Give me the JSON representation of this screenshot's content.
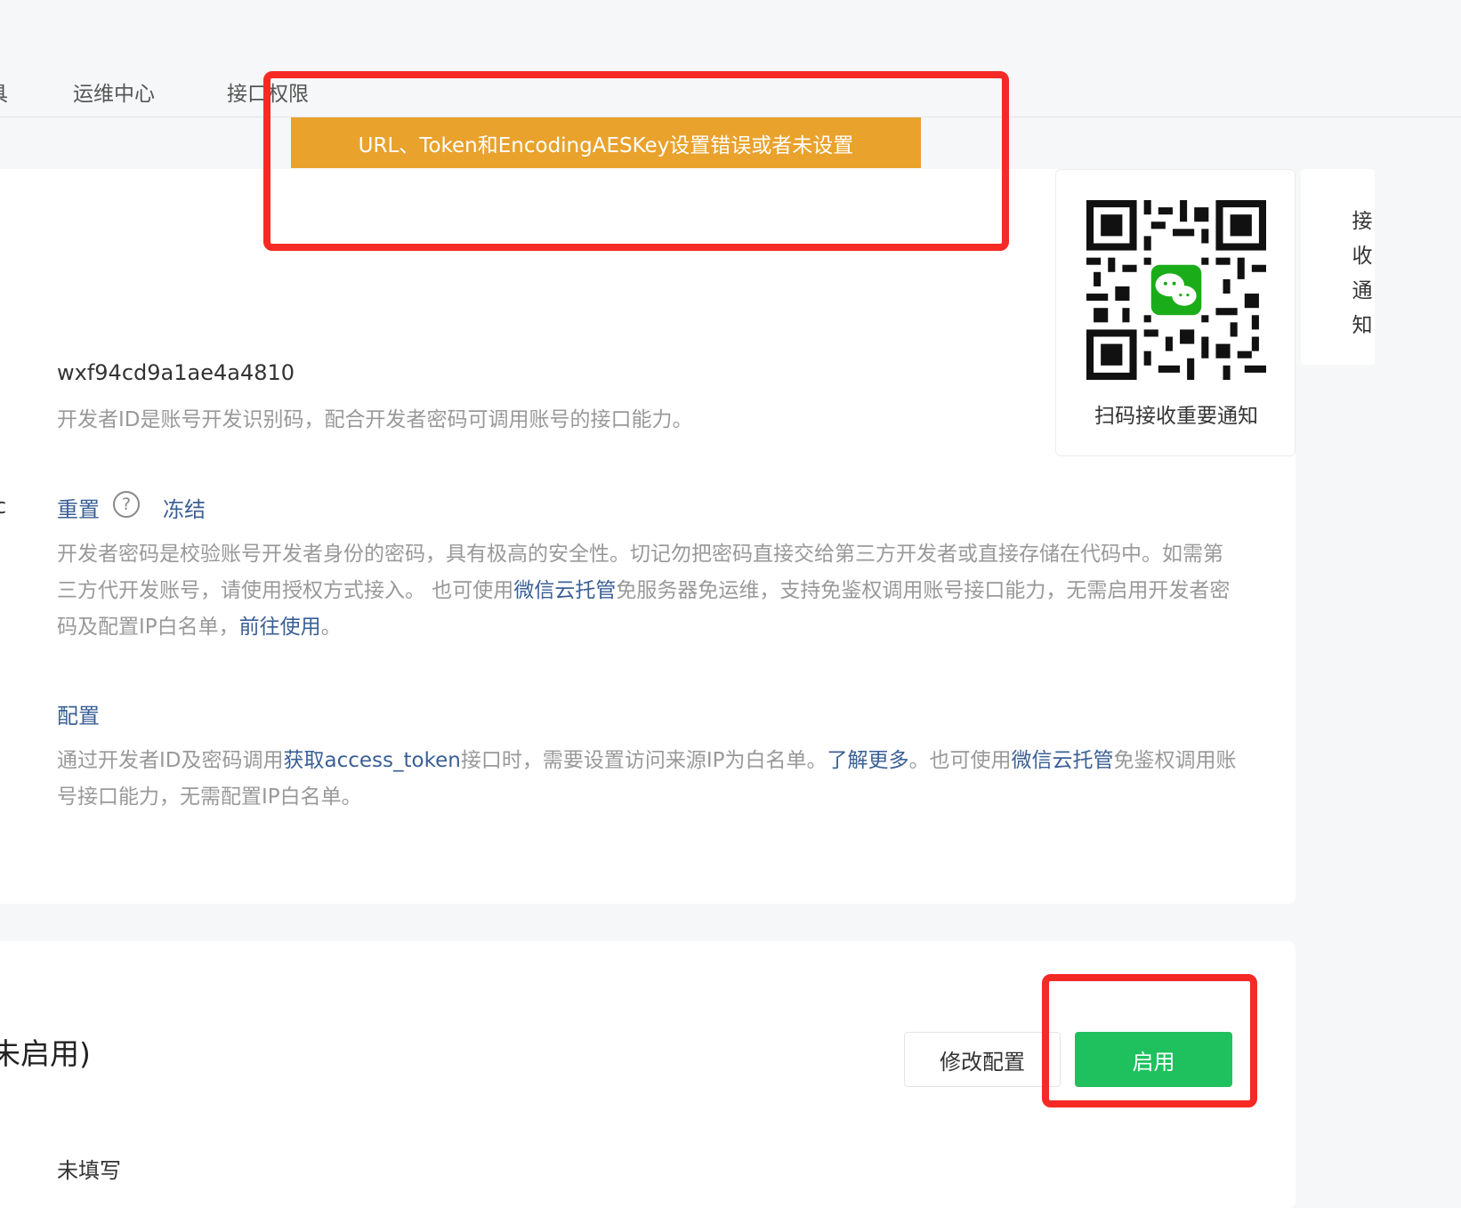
{
  "nav": {
    "items": [
      {
        "label": "具"
      },
      {
        "label": "运维中心"
      },
      {
        "label": "接口权限"
      }
    ]
  },
  "alert": {
    "message": "URL、Token和EncodingAESKey设置错误或者未设置"
  },
  "appid": {
    "value": "wxf94cd9a1ae4a4810",
    "desc": "开发者ID是账号开发识别码，配合开发者密码可调用账号的接口能力。"
  },
  "secret": {
    "fragment": "c",
    "reset_label": "重置",
    "help_glyph": "?",
    "freeze_label": "冻结",
    "desc_1": "开发者密码是校验账号开发者身份的密码，具有极高的安全性。切记勿把密码直接交给第三方开发者或直接存储在代码中。如需第三方代开发账号，请使用授权方式接入。 也可使用",
    "link_cloud": "微信云托管",
    "desc_2": "免服务器免运维，支持免鉴权调用账号接口能力，无需启用开发者密码及配置IP白名单，",
    "link_go": "前往使用",
    "desc_3": "。"
  },
  "ip_whitelist": {
    "config_label": "配置",
    "desc_1": "通过开发者ID及密码调用",
    "link_token": "获取access_token",
    "desc_2": "接口时，需要设置访问来源IP为白名单。",
    "link_more": "了解更多",
    "desc_3": "。也可使用",
    "link_cloud": "微信云托管",
    "desc_4": "免鉴权调用账号接口能力，无需配置IP白名单。"
  },
  "qr": {
    "caption": "扫码接收重要通知",
    "side_tab": "接收通知",
    "colors": {
      "wechat": "#1aad19",
      "qr": "#111111"
    }
  },
  "server": {
    "status": "未启用)",
    "modify_label": "修改配置",
    "enable_label": "启用",
    "url_value": "未填写"
  },
  "colors": {
    "alert": "#e9a22c",
    "primary": "#1fc15f",
    "link": "#3a5f95",
    "highlight": "#f52a24"
  }
}
